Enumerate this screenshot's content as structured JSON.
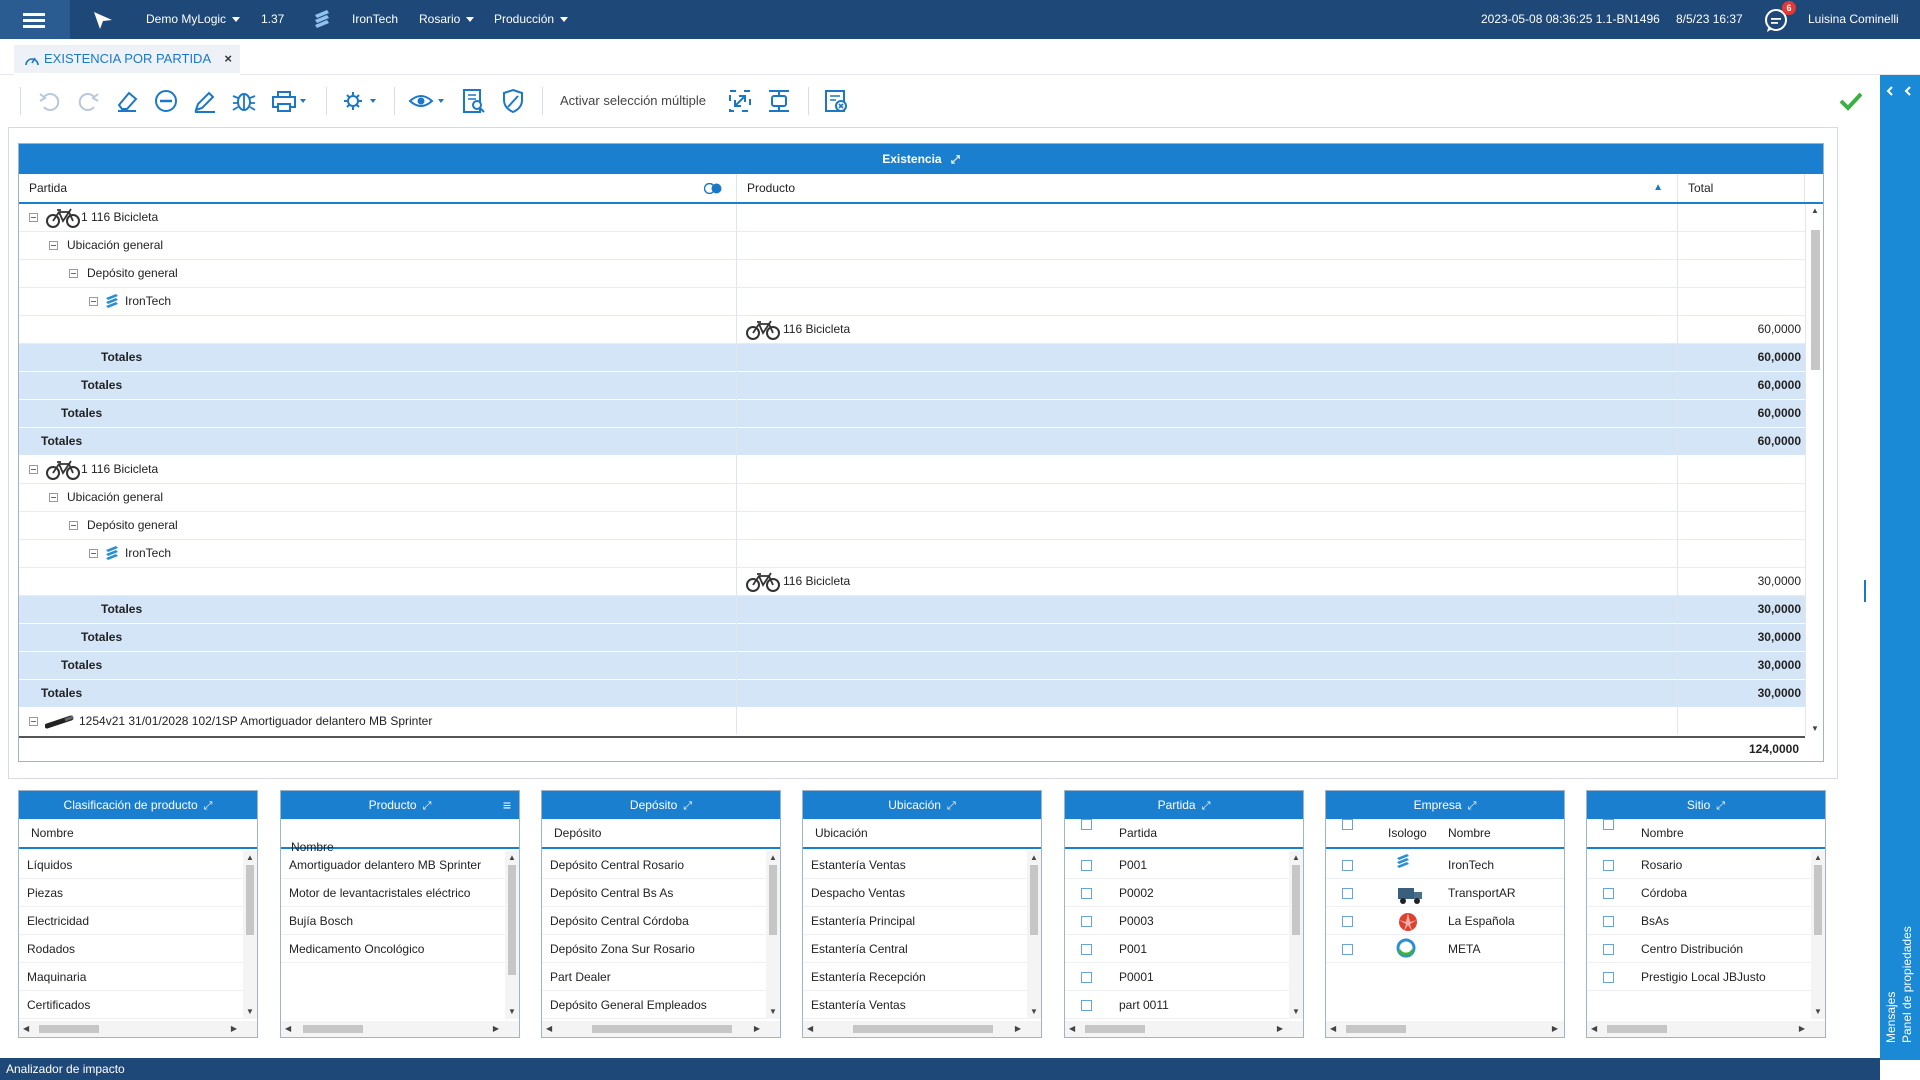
{
  "topbar": {
    "app": "Demo MyLogic",
    "version": "1.37",
    "company": "IronTech",
    "site": "Rosario",
    "module": "Producción",
    "build": "2023-05-08 08:36:25 1.1-BN1496",
    "datetime": "8/5/23 16:37",
    "notifications": "6",
    "user": "Luisina Cominelli"
  },
  "tab": {
    "title": "EXISTENCIA POR PARTIDA",
    "close": "×"
  },
  "toolbar": {
    "multi_select": "Activar selección múltiple"
  },
  "grid": {
    "title": "Existencia",
    "columns": [
      "Partida",
      "Producto",
      "Total"
    ],
    "rows": [
      {
        "type": "node",
        "level": 0,
        "icon": "bicycle-icon",
        "partida": "1 116 Bicicleta",
        "producto": "",
        "total": ""
      },
      {
        "type": "node",
        "level": 1,
        "partida": "Ubicación general",
        "producto": "",
        "total": ""
      },
      {
        "type": "node",
        "level": 2,
        "partida": "Depósito general",
        "producto": "",
        "total": ""
      },
      {
        "type": "node",
        "level": 3,
        "icon": "irontech-logo-icon",
        "partida": "IronTech",
        "producto": "",
        "total": ""
      },
      {
        "type": "leaf",
        "icon": "bicycle-icon",
        "partida": "",
        "producto": "116 Bicicleta",
        "total": "60,0000"
      },
      {
        "type": "total",
        "level": 3,
        "partida": "Totales",
        "total": "60,0000"
      },
      {
        "type": "total",
        "level": 2,
        "partida": "Totales",
        "total": "60,0000"
      },
      {
        "type": "total",
        "level": 1,
        "partida": "Totales",
        "total": "60,0000"
      },
      {
        "type": "total",
        "level": 0,
        "partida": "Totales",
        "total": "60,0000"
      },
      {
        "type": "node",
        "level": 0,
        "icon": "bicycle-icon",
        "partida": "1 116 Bicicleta",
        "producto": "",
        "total": ""
      },
      {
        "type": "node",
        "level": 1,
        "partida": "Ubicación general",
        "producto": "",
        "total": ""
      },
      {
        "type": "node",
        "level": 2,
        "partida": "Depósito general",
        "producto": "",
        "total": ""
      },
      {
        "type": "node",
        "level": 3,
        "icon": "irontech-logo-icon",
        "partida": "IronTech",
        "producto": "",
        "total": ""
      },
      {
        "type": "leaf",
        "icon": "bicycle-icon",
        "partida": "",
        "producto": "116 Bicicleta",
        "total": "30,0000"
      },
      {
        "type": "total",
        "level": 3,
        "partida": "Totales",
        "total": "30,0000"
      },
      {
        "type": "total",
        "level": 2,
        "partida": "Totales",
        "total": "30,0000"
      },
      {
        "type": "total",
        "level": 1,
        "partida": "Totales",
        "total": "30,0000"
      },
      {
        "type": "total",
        "level": 0,
        "partida": "Totales",
        "total": "30,0000"
      },
      {
        "type": "node",
        "level": 0,
        "icon": "shock-absorber-icon",
        "partida": "1254v21 31/01/2028 102/1SP Amortiguador delantero MB Sprinter",
        "producto": "",
        "total": ""
      }
    ],
    "grand_total": "124,0000"
  },
  "filters": [
    {
      "title": "Clasificación de producto",
      "columns": [
        "Nombre"
      ],
      "items": [
        "Líquidos",
        "Piezas",
        "Electricidad",
        "Rodados",
        "Maquinaria",
        "Certificados"
      ]
    },
    {
      "title": "Producto",
      "columns": [
        "Nombre"
      ],
      "items": [
        "Amortiguador delantero MB Sprinter",
        "Motor de levantacristales eléctrico",
        "Bujía Bosch",
        "Medicamento Oncológico"
      ]
    },
    {
      "title": "Depósito",
      "columns": [
        "Depósito"
      ],
      "items": [
        "Depósito Central Rosario",
        "Depósito Central Bs As",
        "Depósito Central Córdoba",
        "Depósito Zona Sur Rosario",
        "Part Dealer",
        "Depósito General Empleados"
      ]
    },
    {
      "title": "Ubicación",
      "columns": [
        "Ubicación"
      ],
      "items": [
        "Estantería Ventas",
        "Despacho Ventas",
        "Estantería Principal",
        "Estantería Central",
        "Estantería Recepción",
        "Estantería Ventas"
      ]
    },
    {
      "title": "Partida",
      "columns": [
        "Partida"
      ],
      "items": [
        "P001",
        "P0002",
        "P0003",
        "P001",
        "P0001",
        "part 0011"
      ]
    },
    {
      "title": "Empresa",
      "columns": [
        "Isologo",
        "Nombre"
      ],
      "items": [
        "IronTech",
        "TransportAR",
        "La Española",
        "META"
      ]
    },
    {
      "title": "Sitio",
      "columns": [
        "Nombre"
      ],
      "items": [
        "Rosario",
        "Córdoba",
        "BsAs",
        "Centro Distribución",
        "Prestigio Local JBJusto"
      ]
    }
  ],
  "side_panel": {
    "properties": "Panel de propiedades",
    "messages": "Mensajes"
  },
  "statusbar": {
    "text": "Analizador de impacto"
  },
  "colors": {
    "topbar": "#1e4877",
    "accent": "#1b7fd0",
    "totals_row": "#d4e5f7",
    "confirm": "#3cb043"
  }
}
